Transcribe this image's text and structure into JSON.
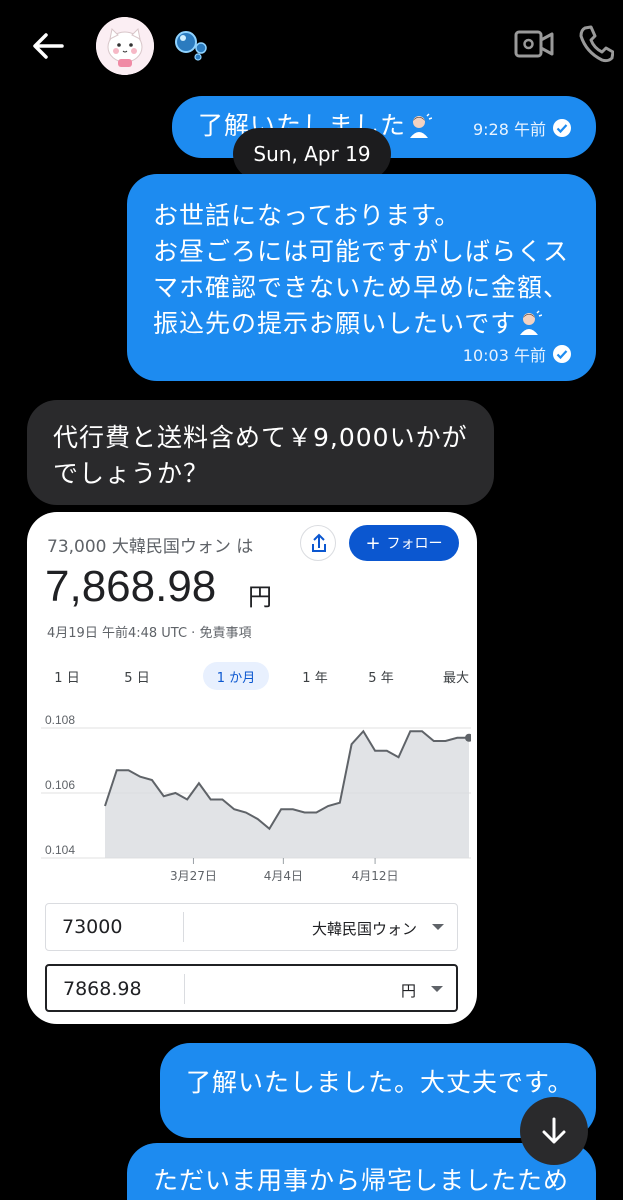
{
  "messages": [
    {
      "text": "了解いたしました",
      "time": "9:28 午前"
    },
    {
      "text": "お世話になっております。\nお昼ごろには可能ですがしばらくス\nマホ確認できないため早めに金額、\n振込先の提示お願いしたいです",
      "time": "10:03 午前"
    },
    {
      "text": "代行費と送料含めて￥9,000いかが\nでしょうか？"
    },
    {
      "text": "了解いたしました。大丈夫です。"
    },
    {
      "text": "ただいま用事から帰宅しましたため"
    }
  ],
  "date_separator": "Sun, Apr 19",
  "card": {
    "subtitle": "73,000 大韓民国ウォン は",
    "value": "7,868.98",
    "unit": "円",
    "timestamp": "4月19日 午前4:48 UTC · 免責事項",
    "follow_label": "フォロー",
    "tabs": [
      "1 日",
      "5 日",
      "1 か月",
      "1 年",
      "5 年",
      "最大"
    ],
    "active_tab": "1 か月",
    "from_amount": "73000",
    "from_currency": "大韓民国ウォン",
    "to_amount": "7868.98",
    "to_currency": "円"
  },
  "chart_data": {
    "type": "area",
    "y_ticks": [
      "0.108",
      "0.106",
      "0.104"
    ],
    "ylim": [
      0.104,
      0.108
    ],
    "x_ticks": [
      "3月27日",
      "4月4日",
      "4月12日"
    ],
    "values": [
      0.1056,
      0.1067,
      0.1067,
      0.1065,
      0.1064,
      0.1059,
      0.106,
      0.1058,
      0.1063,
      0.1058,
      0.1058,
      0.1055,
      0.1054,
      0.1052,
      0.1049,
      0.1055,
      0.1055,
      0.1054,
      0.1054,
      0.1056,
      0.1057,
      0.1075,
      0.1079,
      0.1073,
      0.1073,
      0.1071,
      0.1079,
      0.1079,
      0.1076,
      0.1076,
      0.1077,
      0.1077
    ],
    "colors": {
      "line": "#5f6368",
      "fill": "#dadce0",
      "grid": "#e0e0e0"
    }
  }
}
